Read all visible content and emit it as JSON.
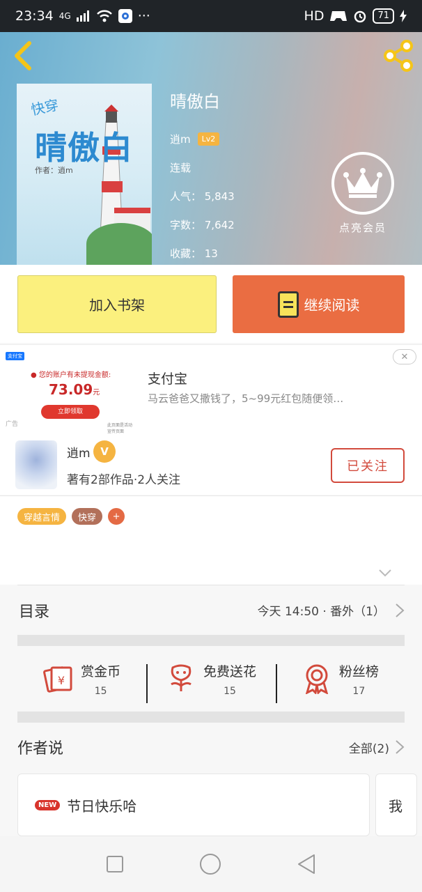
{
  "status_bar": {
    "time": "23:34",
    "network": "4G",
    "hd": "HD",
    "battery": "71",
    "more": "···"
  },
  "book": {
    "title": "晴傲白",
    "author": "逍m",
    "level": "Lv2",
    "status": "连载",
    "popularity": "人气： 5,843",
    "word_count": "字数： 7,642",
    "favorites": "收藏： 13",
    "cover": {
      "tag": "快穿",
      "title": "晴傲白",
      "author": "作者：逍m"
    }
  },
  "vip": {
    "label": "点亮会员"
  },
  "actions": {
    "add_shelf": "加入书架",
    "continue_read": "继续阅读"
  },
  "ad": {
    "logo": "支付宝",
    "note": "● 您的账户有未提现金额:",
    "amount": "73.09",
    "amount_unit": "元",
    "cta": "立即领取",
    "tag": "广告",
    "mini": "此页面是活动宣传页面",
    "brand": "支付宝",
    "description": "马云爸爸又撒钱了，5~99元红包随便领…",
    "close": "✕"
  },
  "author": {
    "name": "逍m",
    "badge": "V",
    "stats": "著有2部作品·2人关注",
    "follow_label": "已关注"
  },
  "tags": [
    "穿越言情",
    "快穿"
  ],
  "tag_add": "+",
  "catalog": {
    "title": "目录",
    "latest": "今天 14:50 · 番外（1）"
  },
  "stats": [
    {
      "label": "赏金币",
      "value": "15",
      "icon": "coin-icon"
    },
    {
      "label": "免费送花",
      "value": "15",
      "icon": "flower-icon"
    },
    {
      "label": "粉丝榜",
      "value": "17",
      "icon": "medal-icon"
    }
  ],
  "notes": {
    "title": "作者说",
    "all": "全部(2)",
    "items": [
      {
        "badge": "NEW",
        "text": "节日快乐哈"
      }
    ],
    "next_preview": "我"
  }
}
